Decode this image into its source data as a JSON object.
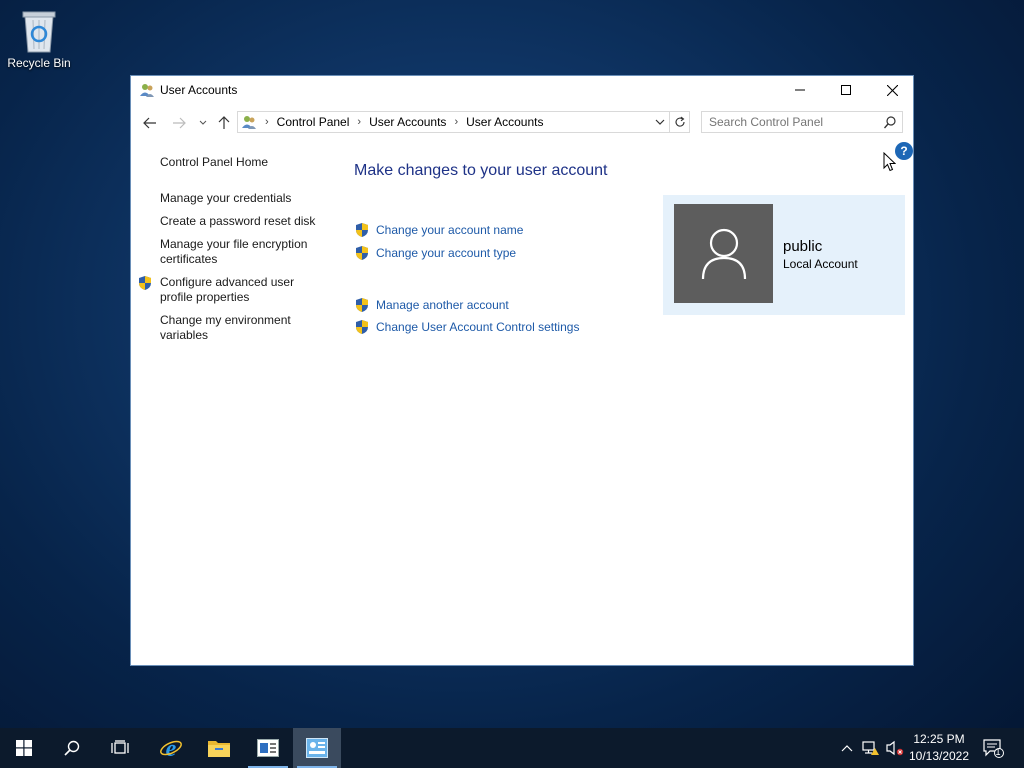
{
  "desktop": {
    "recycle_bin_label": "Recycle Bin"
  },
  "window": {
    "title": "User Accounts",
    "app_icon": "users-icon",
    "controls": [
      "minimize-icon",
      "maximize-icon",
      "close-icon"
    ]
  },
  "navbar": {
    "breadcrumbs": [
      "Control Panel",
      "User Accounts",
      "User Accounts"
    ],
    "search_placeholder": "Search Control Panel"
  },
  "left_pane": {
    "home": "Control Panel Home",
    "items": [
      {
        "label": "Manage your credentials",
        "shield": false
      },
      {
        "label": "Create a password reset disk",
        "shield": false
      },
      {
        "label": "Manage your file encryption certificates",
        "shield": false
      },
      {
        "label": "Configure advanced user profile properties",
        "shield": true
      },
      {
        "label": "Change my environment variables",
        "shield": false
      }
    ]
  },
  "main": {
    "heading": "Make changes to your user account",
    "tasks": [
      {
        "label": "Change your account name",
        "shield": true
      },
      {
        "label": "Change your account type",
        "shield": true
      },
      {
        "label": "Manage another account",
        "shield": true
      },
      {
        "label": "Change User Account Control settings",
        "shield": true
      }
    ],
    "help_label": "?"
  },
  "user_card": {
    "name": "public",
    "account_type": "Local Account"
  },
  "taskbar": {
    "buttons": [
      "windows-start-icon",
      "search-icon",
      "task-view-icon",
      "internet-explorer-icon",
      "file-explorer-icon",
      "server-manager-icon",
      "control-panel-icon"
    ],
    "clock_time": "12:25 PM",
    "clock_date": "10/13/2022",
    "notification_count": "1"
  },
  "colors": {
    "link": "#1e5aa8",
    "heading": "#1e3287",
    "user_card_bg": "#e5f1fb",
    "taskbar_bg": "#0c1a2c"
  }
}
